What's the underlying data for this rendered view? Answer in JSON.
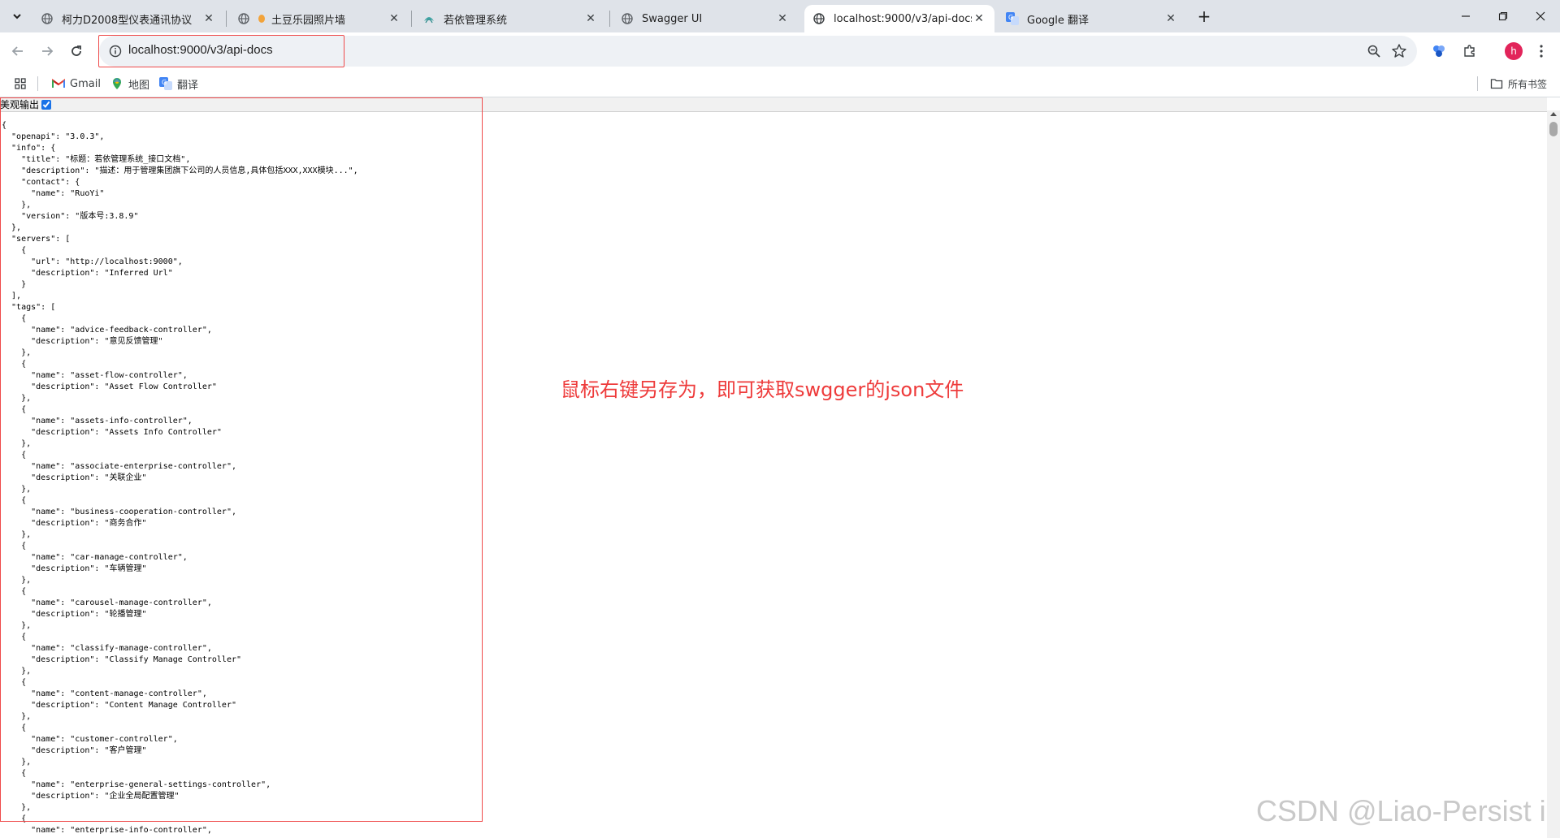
{
  "tabs": [
    {
      "title": "柯力D2008型仪表通讯协议",
      "active": false,
      "favicon": "globe-icon"
    },
    {
      "title": "土豆乐园照片墙",
      "active": false,
      "favicon": "potato-icon"
    },
    {
      "title": "若依管理系统",
      "active": false,
      "favicon": "ruoyi-leaf-icon"
    },
    {
      "title": "Swagger UI",
      "active": false,
      "favicon": "globe-icon"
    },
    {
      "title": "localhost:9000/v3/api-docs",
      "active": true,
      "favicon": "globe-icon"
    },
    {
      "title": "Google 翻译",
      "active": false,
      "favicon": "google-translate-icon"
    }
  ],
  "address_bar": {
    "url": "localhost:9000/v3/api-docs"
  },
  "profile": {
    "initial": "h",
    "color": "#e2245a"
  },
  "bookmarks": {
    "items": [
      {
        "label": "Gmail",
        "icon": "gmail-icon"
      },
      {
        "label": "地图",
        "icon": "maps-icon"
      },
      {
        "label": "翻译",
        "icon": "translate-icon"
      }
    ],
    "all_bookmarks": "所有书签"
  },
  "page": {
    "pretty_print_label": "美观输出",
    "pretty_print_checked": true,
    "json_lines": [
      "{",
      "  \"openapi\": \"3.0.3\",",
      "  \"info\": {",
      "    \"title\": \"标题：若依管理系统_接口文档\",",
      "    \"description\": \"描述：用于管理集团旗下公司的人员信息,具体包括XXX,XXX模块...\",",
      "    \"contact\": {",
      "      \"name\": \"RuoYi\"",
      "    },",
      "    \"version\": \"版本号:3.8.9\"",
      "  },",
      "  \"servers\": [",
      "    {",
      "      \"url\": \"http://localhost:9000\",",
      "      \"description\": \"Inferred Url\"",
      "    }",
      "  ],",
      "  \"tags\": [",
      "    {",
      "      \"name\": \"advice-feedback-controller\",",
      "      \"description\": \"意见反馈管理\"",
      "    },",
      "    {",
      "      \"name\": \"asset-flow-controller\",",
      "      \"description\": \"Asset Flow Controller\"",
      "    },",
      "    {",
      "      \"name\": \"assets-info-controller\",",
      "      \"description\": \"Assets Info Controller\"",
      "    },",
      "    {",
      "      \"name\": \"associate-enterprise-controller\",",
      "      \"description\": \"关联企业\"",
      "    },",
      "    {",
      "      \"name\": \"business-cooperation-controller\",",
      "      \"description\": \"商务合作\"",
      "    },",
      "    {",
      "      \"name\": \"car-manage-controller\",",
      "      \"description\": \"车辆管理\"",
      "    },",
      "    {",
      "      \"name\": \"carousel-manage-controller\",",
      "      \"description\": \"轮播管理\"",
      "    },",
      "    {",
      "      \"name\": \"classify-manage-controller\",",
      "      \"description\": \"Classify Manage Controller\"",
      "    },",
      "    {",
      "      \"name\": \"content-manage-controller\",",
      "      \"description\": \"Content Manage Controller\"",
      "    },",
      "    {",
      "      \"name\": \"customer-controller\",",
      "      \"description\": \"客户管理\"",
      "    },",
      "    {",
      "      \"name\": \"enterprise-general-settings-controller\",",
      "      \"description\": \"企业全局配置管理\"",
      "    },",
      "    {",
      "      \"name\": \"enterprise-info-controller\","
    ],
    "annotation": "鼠标右键另存为，即可获取swgger的json文件",
    "watermark": "CSDN @Liao-Persist in"
  },
  "colors": {
    "highlight_border": "#ef4b4b",
    "annotation_text": "#ee3b3b",
    "tabstrip_bg": "#dfe3e9"
  }
}
